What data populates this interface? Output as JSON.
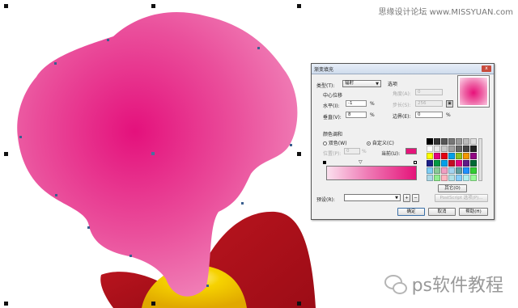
{
  "watermark": {
    "top": "思缘设计论坛 www.MISSYUAN.com",
    "bottom": "ps软件教程"
  },
  "dialog": {
    "title": "渐变填充",
    "close": "x",
    "type_label": "类型(T):",
    "type_value": "辐射",
    "options_label": "选项",
    "angle_label": "角度(A):",
    "angle_value": "0",
    "center_label": "中心位移",
    "steps_label": "步长(S):",
    "steps_value": "256",
    "horizontal_label": "水平(I):",
    "horizontal_value": "-1",
    "percent": "%",
    "vertical_label": "垂直(V):",
    "vertical_value": "8",
    "edge_pad_label": "边界(E):",
    "edge_pad_value": "0",
    "color_blend_label": "颜色调和",
    "two_color_label": "双色(W)",
    "custom_label": "自定义(C)",
    "position_label": "位置(P):",
    "position_value": "0",
    "current_label": "当前(U):",
    "presets_label": "预设(R):",
    "postscript_button": "PostScript 选项(P)...",
    "others_button": "其它(O)",
    "ok_button": "确定",
    "cancel_button": "取消",
    "help_button": "帮助(H)",
    "plus": "+",
    "minus": "−"
  },
  "palette_colors": [
    "#000000",
    "#333333",
    "#555555",
    "#777777",
    "#999999",
    "#bbbbbb",
    "#dddddd",
    "#ffffff",
    "#e6e6e6",
    "#c8c8c8",
    "#a0a0a0",
    "#666666",
    "#444444",
    "#222222",
    "#ffff00",
    "#e4007f",
    "#e60012",
    "#00a0e9",
    "#8fc31f",
    "#f39800",
    "#920783",
    "#1d2088",
    "#009944",
    "#00a0e9",
    "#c30d23",
    "#e4007f",
    "#601986",
    "#006934",
    "#7ecef4",
    "#89c997",
    "#f19ec2",
    "#a3d4f0",
    "#5f9ea0",
    "#1e90ff",
    "#32cd32",
    "#add8e6",
    "#90ee90",
    "#ffb6c1",
    "#b0e0e6",
    "#87cefa",
    "#afeeee",
    "#98fb98"
  ],
  "colors": {
    "petal_pink": "#e8338e",
    "petal_red": "#b0151f",
    "petal_yellow": "#f0c800"
  }
}
